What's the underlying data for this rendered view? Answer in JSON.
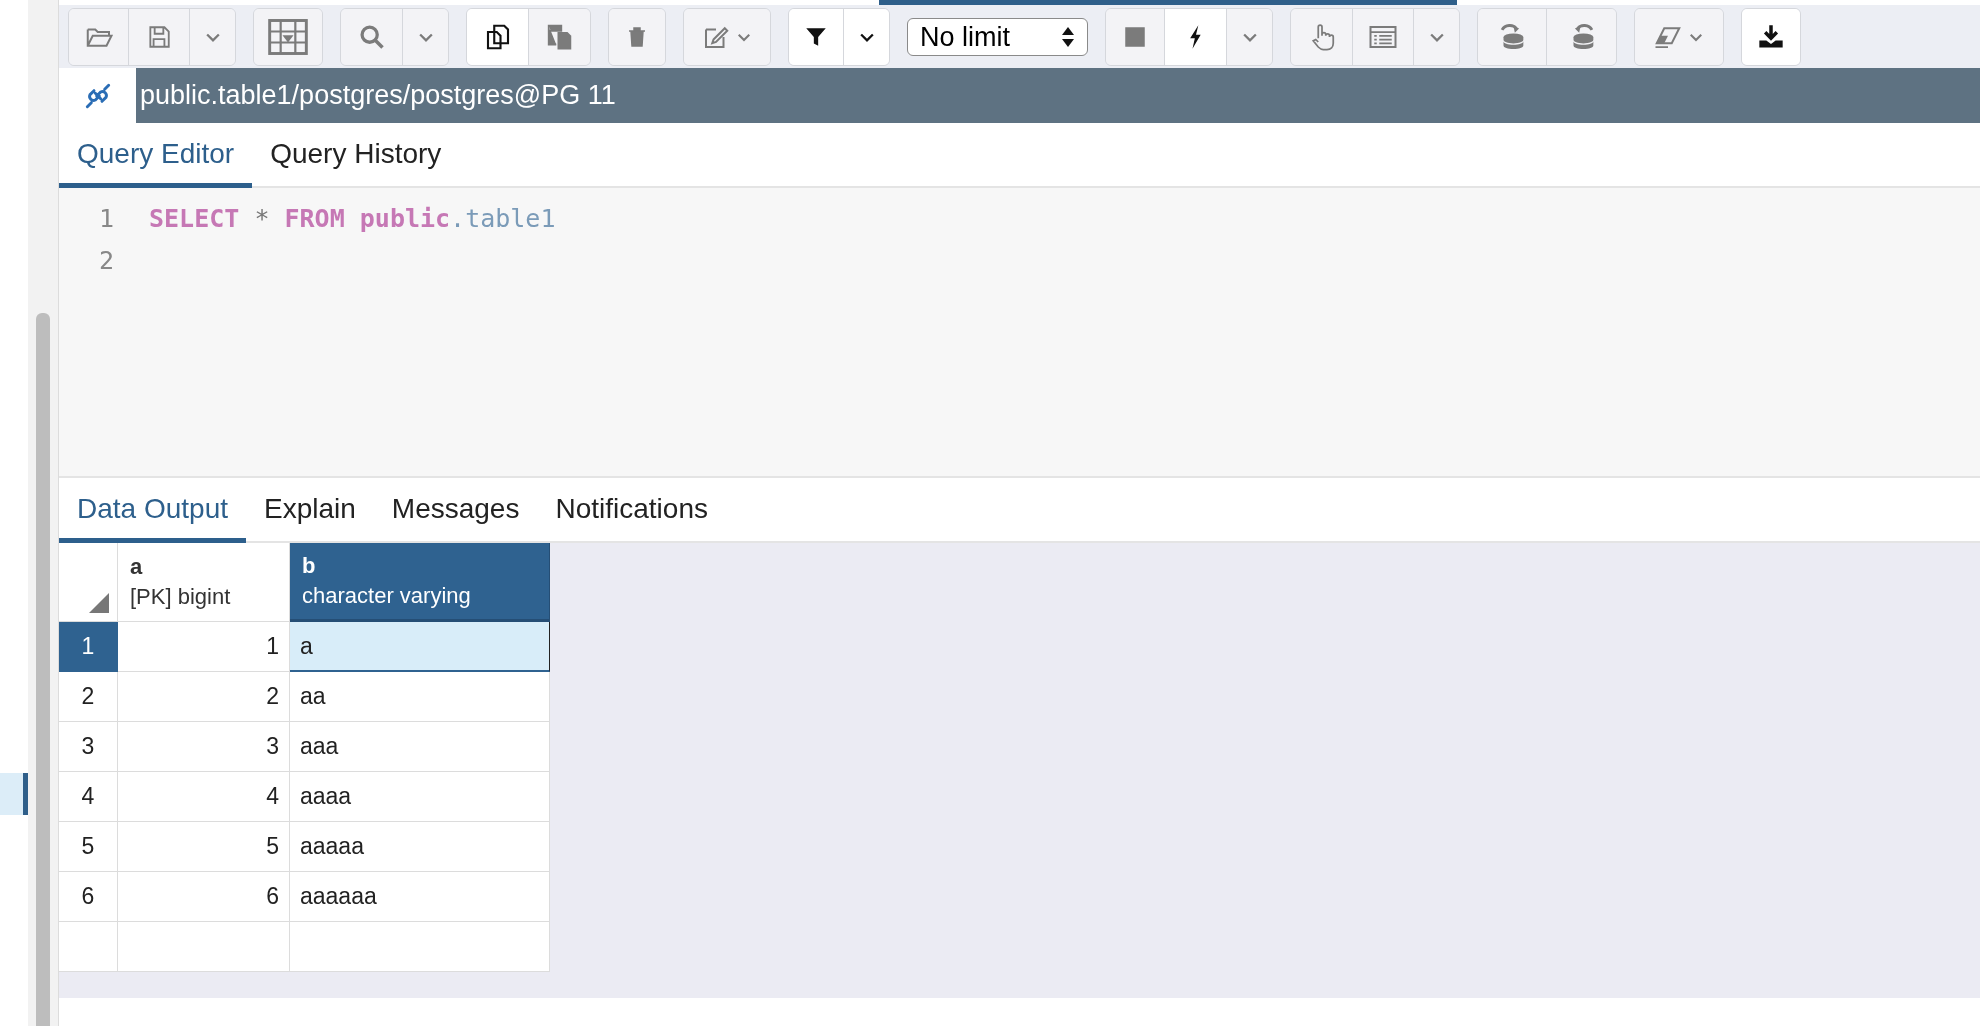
{
  "toolbar": {
    "groups": [
      [
        {
          "kind": "open",
          "disabled": true
        },
        {
          "kind": "save",
          "disabled": true
        },
        {
          "kind": "caret",
          "disabled": true
        }
      ],
      [
        {
          "kind": "save-data",
          "disabled": true
        }
      ],
      [
        {
          "kind": "find",
          "disabled": true
        },
        {
          "kind": "caret",
          "disabled": true
        }
      ],
      [
        {
          "kind": "copy",
          "disabled": false
        },
        {
          "kind": "paste",
          "disabled": true
        }
      ],
      [
        {
          "kind": "delete",
          "disabled": true
        }
      ],
      [
        {
          "kind": "edit",
          "disabled": true
        }
      ],
      [
        {
          "kind": "filter",
          "disabled": false
        },
        {
          "kind": "caret",
          "disabled": false
        }
      ],
      [
        {
          "kind": "limit",
          "value": "No limit"
        }
      ],
      [
        {
          "kind": "stop",
          "disabled": true
        },
        {
          "kind": "execute",
          "disabled": false
        },
        {
          "kind": "caret",
          "disabled": true
        }
      ],
      [
        {
          "kind": "explain",
          "disabled": true
        },
        {
          "kind": "explain-analyze",
          "disabled": true
        },
        {
          "kind": "caret",
          "disabled": true
        }
      ],
      [
        {
          "kind": "commit",
          "disabled": true
        },
        {
          "kind": "rollback",
          "disabled": true
        }
      ],
      [
        {
          "kind": "clear",
          "disabled": true
        }
      ],
      [
        {
          "kind": "download",
          "disabled": false
        }
      ]
    ]
  },
  "connection": {
    "title": "public.table1/postgres/postgres@PG 11"
  },
  "editor_tabs": [
    {
      "label": "Query Editor",
      "selected": true
    },
    {
      "label": "Query History",
      "selected": false
    }
  ],
  "editor": {
    "lines": [
      {
        "number": "1",
        "tokens": [
          {
            "kind": "keyword",
            "text": "SELECT"
          },
          {
            "kind": "operator",
            "text": "*"
          },
          {
            "kind": "keyword",
            "text": "FROM"
          },
          {
            "kind": "variable",
            "text": "public"
          },
          {
            "kind": "property",
            "text": ".table1"
          }
        ]
      },
      {
        "number": "2"
      }
    ]
  },
  "output_tabs": [
    {
      "label": "Data Output",
      "selected": true
    },
    {
      "label": "Explain",
      "selected": false
    },
    {
      "label": "Messages",
      "selected": false
    },
    {
      "label": "Notifications",
      "selected": false
    }
  ],
  "grid": {
    "columns": [
      {
        "name": "a",
        "type": "[PK] bigint",
        "selected": false
      },
      {
        "name": "b",
        "type": "character varying",
        "selected": true
      }
    ],
    "rows": [
      {
        "number": "1",
        "cells": [
          "1",
          "a"
        ],
        "selected": true
      },
      {
        "number": "2",
        "cells": [
          "2",
          "aa"
        ],
        "selected": false
      },
      {
        "number": "3",
        "cells": [
          "3",
          "aaa"
        ],
        "selected": false
      },
      {
        "number": "4",
        "cells": [
          "4",
          "aaaa"
        ],
        "selected": false
      },
      {
        "number": "5",
        "cells": [
          "5",
          "aaaaa"
        ],
        "selected": false
      },
      {
        "number": "6",
        "cells": [
          "6",
          "aaaaaa"
        ],
        "selected": false
      }
    ]
  }
}
